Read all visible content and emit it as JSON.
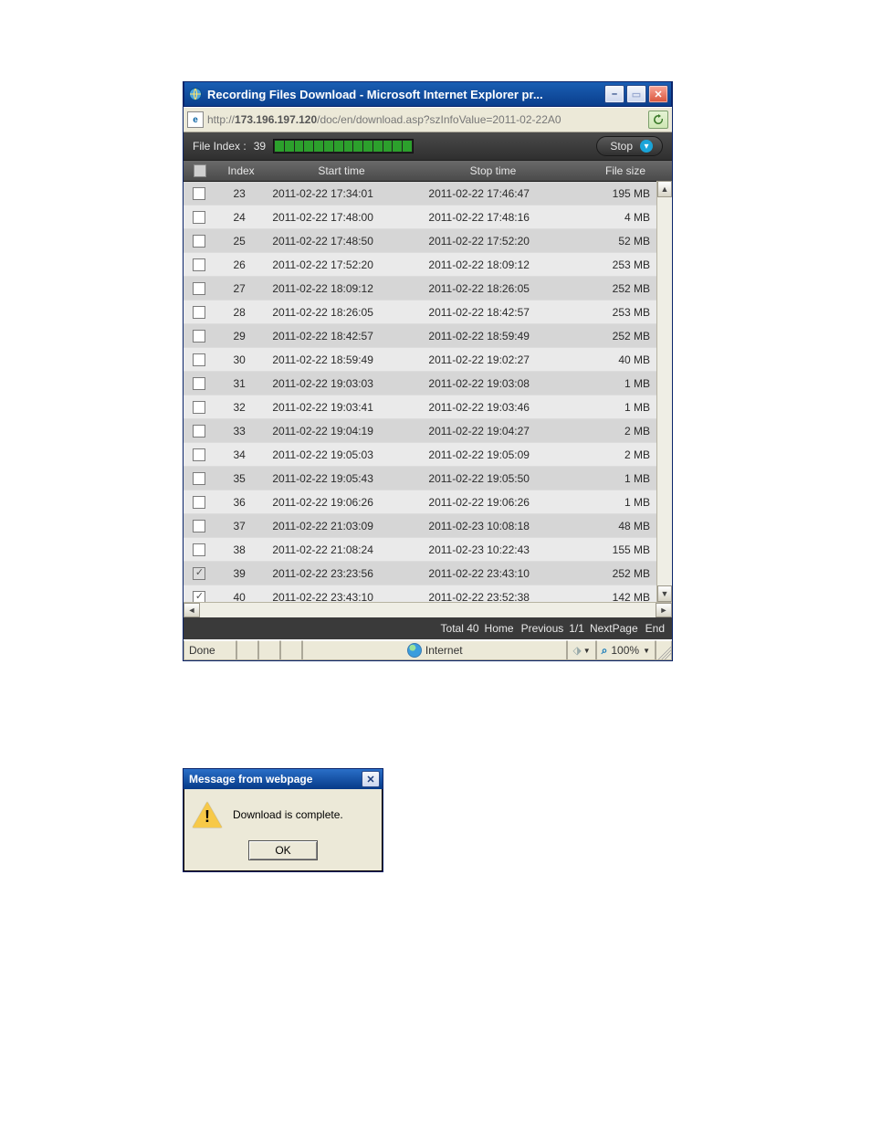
{
  "window": {
    "title": "Recording Files Download - Microsoft Internet Explorer pr...",
    "url_prefix": "http://",
    "url_host": "173.196.197.120",
    "url_path": "/doc/en/download.asp?szInfoValue=2011-02-22A0"
  },
  "toolbar": {
    "file_index_label": "File Index :",
    "file_index_value": "39",
    "stop_label": "Stop"
  },
  "headers": {
    "index": "Index",
    "start": "Start time",
    "stop": "Stop time",
    "size": "File size"
  },
  "rows": [
    {
      "chk": "",
      "idx": "23",
      "start": "2011-02-22 17:34:01",
      "stop": "2011-02-22 17:46:47",
      "size": "195 MB"
    },
    {
      "chk": "",
      "idx": "24",
      "start": "2011-02-22 17:48:00",
      "stop": "2011-02-22 17:48:16",
      "size": "4 MB"
    },
    {
      "chk": "",
      "idx": "25",
      "start": "2011-02-22 17:48:50",
      "stop": "2011-02-22 17:52:20",
      "size": "52 MB"
    },
    {
      "chk": "",
      "idx": "26",
      "start": "2011-02-22 17:52:20",
      "stop": "2011-02-22 18:09:12",
      "size": "253 MB"
    },
    {
      "chk": "",
      "idx": "27",
      "start": "2011-02-22 18:09:12",
      "stop": "2011-02-22 18:26:05",
      "size": "252 MB"
    },
    {
      "chk": "",
      "idx": "28",
      "start": "2011-02-22 18:26:05",
      "stop": "2011-02-22 18:42:57",
      "size": "253 MB"
    },
    {
      "chk": "",
      "idx": "29",
      "start": "2011-02-22 18:42:57",
      "stop": "2011-02-22 18:59:49",
      "size": "252 MB"
    },
    {
      "chk": "",
      "idx": "30",
      "start": "2011-02-22 18:59:49",
      "stop": "2011-02-22 19:02:27",
      "size": "40 MB"
    },
    {
      "chk": "",
      "idx": "31",
      "start": "2011-02-22 19:03:03",
      "stop": "2011-02-22 19:03:08",
      "size": "1 MB"
    },
    {
      "chk": "",
      "idx": "32",
      "start": "2011-02-22 19:03:41",
      "stop": "2011-02-22 19:03:46",
      "size": "1 MB"
    },
    {
      "chk": "",
      "idx": "33",
      "start": "2011-02-22 19:04:19",
      "stop": "2011-02-22 19:04:27",
      "size": "2 MB"
    },
    {
      "chk": "",
      "idx": "34",
      "start": "2011-02-22 19:05:03",
      "stop": "2011-02-22 19:05:09",
      "size": "2 MB"
    },
    {
      "chk": "",
      "idx": "35",
      "start": "2011-02-22 19:05:43",
      "stop": "2011-02-22 19:05:50",
      "size": "1 MB"
    },
    {
      "chk": "",
      "idx": "36",
      "start": "2011-02-22 19:06:26",
      "stop": "2011-02-22 19:06:26",
      "size": "1 MB"
    },
    {
      "chk": "",
      "idx": "37",
      "start": "2011-02-22 21:03:09",
      "stop": "2011-02-23 10:08:18",
      "size": "48 MB"
    },
    {
      "chk": "",
      "idx": "38",
      "start": "2011-02-22 21:08:24",
      "stop": "2011-02-23 10:22:43",
      "size": "155 MB"
    },
    {
      "chk": "g",
      "idx": "39",
      "start": "2011-02-22 23:23:56",
      "stop": "2011-02-22 23:43:10",
      "size": "252 MB"
    },
    {
      "chk": "c",
      "idx": "40",
      "start": "2011-02-22 23:43:10",
      "stop": "2011-02-22 23:52:38",
      "size": "142 MB"
    }
  ],
  "pager": {
    "total_label": "Total 40",
    "home": "Home",
    "prev": "Previous",
    "page": "1/1",
    "next": "NextPage",
    "end": "End"
  },
  "status": {
    "done": "Done",
    "zone": "Internet",
    "zoom": "100%"
  },
  "dialog": {
    "title": "Message from webpage",
    "message": "Download is complete.",
    "ok": "OK"
  }
}
